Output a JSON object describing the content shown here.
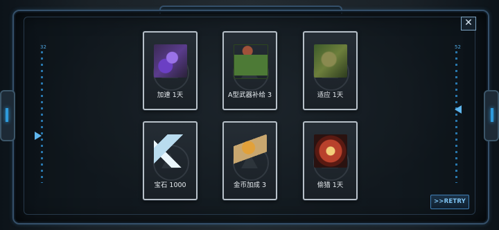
{
  "rewards": [
    {
      "label": "加速 1天",
      "icon": "speed-boost-icon"
    },
    {
      "label": "A型武器补给 3",
      "icon": "weapon-crate-icon"
    },
    {
      "label": "适应 1天",
      "icon": "adaptation-icon"
    },
    {
      "label": "宝石 1000",
      "icon": "gem-icon"
    },
    {
      "label": "金币加成 3",
      "icon": "gold-bonus-icon"
    },
    {
      "label": "偷猎 1天",
      "icon": "poaching-icon"
    }
  ],
  "gauges": {
    "left_value": "32",
    "right_value": "52"
  },
  "close_label": "✕",
  "retry_label": ">>RETRY",
  "colors": {
    "frame": "#35506a",
    "accent": "#2e9bdc",
    "card_border": "#b7c0c8"
  }
}
